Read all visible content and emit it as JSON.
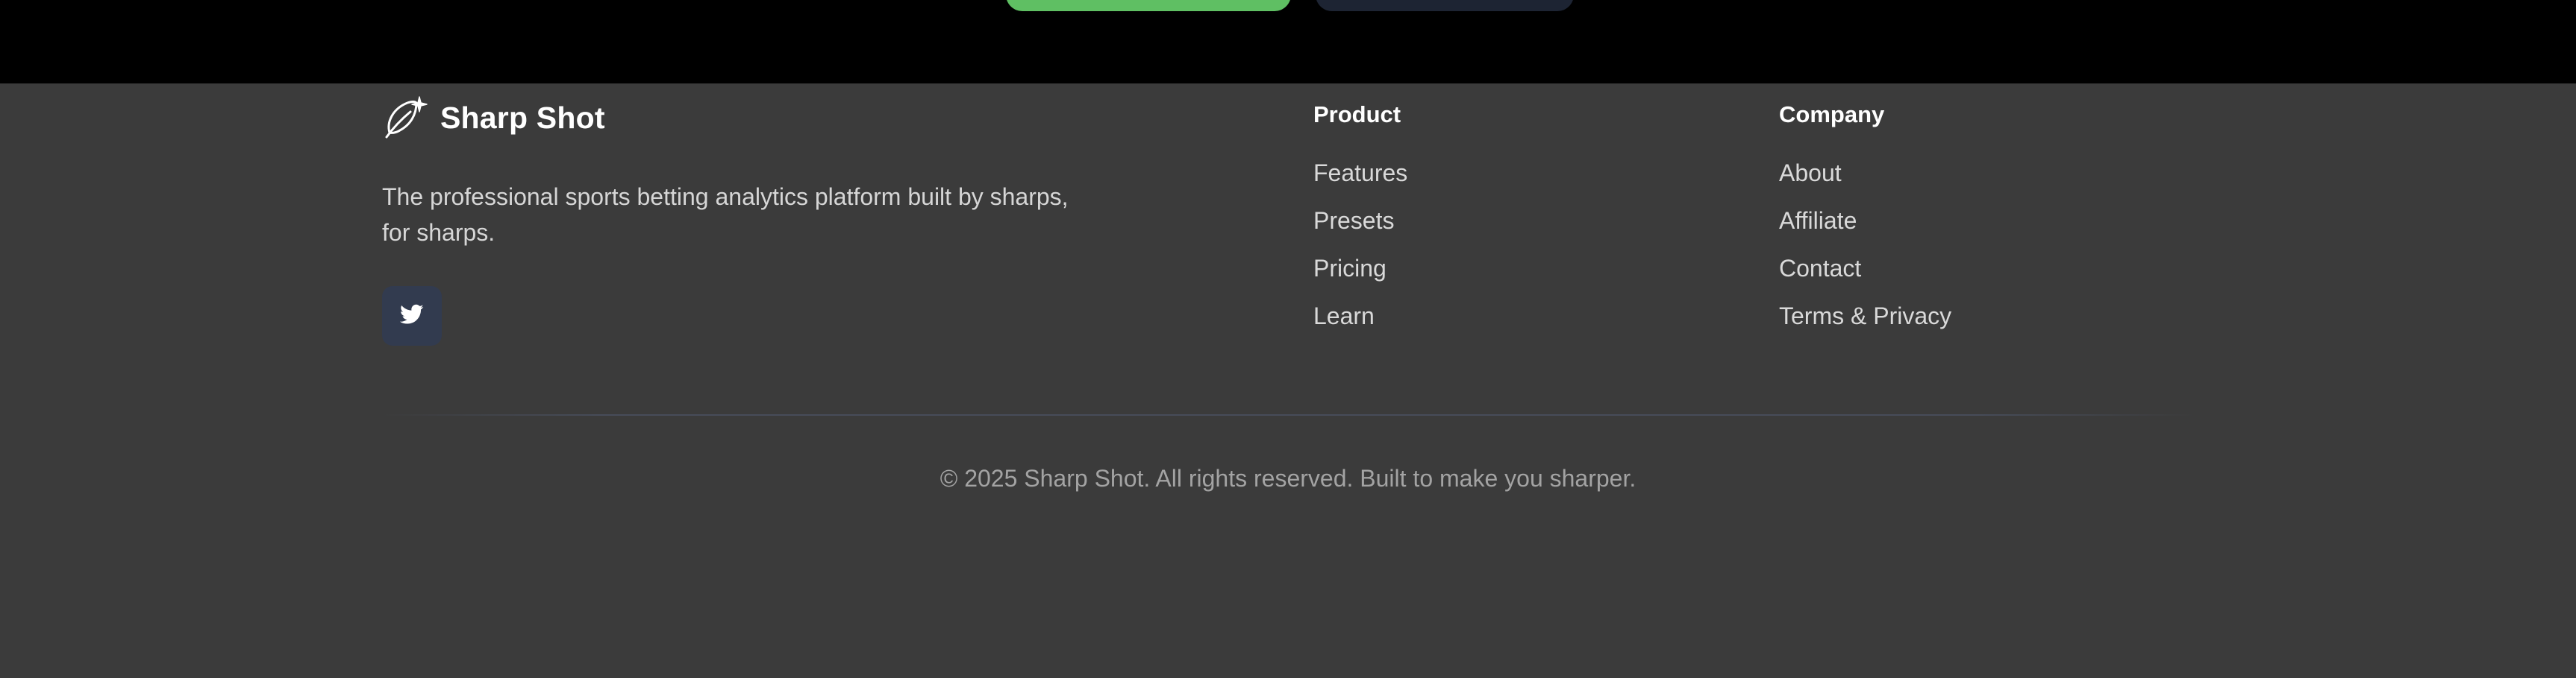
{
  "brand": {
    "name": "Sharp Shot",
    "icon": "feather-sparkle-logo-icon",
    "tagline": "The professional sports betting analytics platform built by sharps, for sharps."
  },
  "social": {
    "icon": "twitter-icon"
  },
  "columns": {
    "product": {
      "title": "Product",
      "links": [
        "Features",
        "Presets",
        "Pricing",
        "Learn"
      ]
    },
    "company": {
      "title": "Company",
      "links": [
        "About",
        "Affiliate",
        "Contact",
        "Terms & Privacy"
      ]
    }
  },
  "copyright": "© 2025 Sharp Shot. All rights reserved. Built to make you sharper.",
  "colors": {
    "footer_bg": "#3b3b3b",
    "top_bg": "#000000",
    "accent_green": "#5fbf63",
    "dark_button": "#1d2433",
    "social_bg": "#323b4f"
  }
}
